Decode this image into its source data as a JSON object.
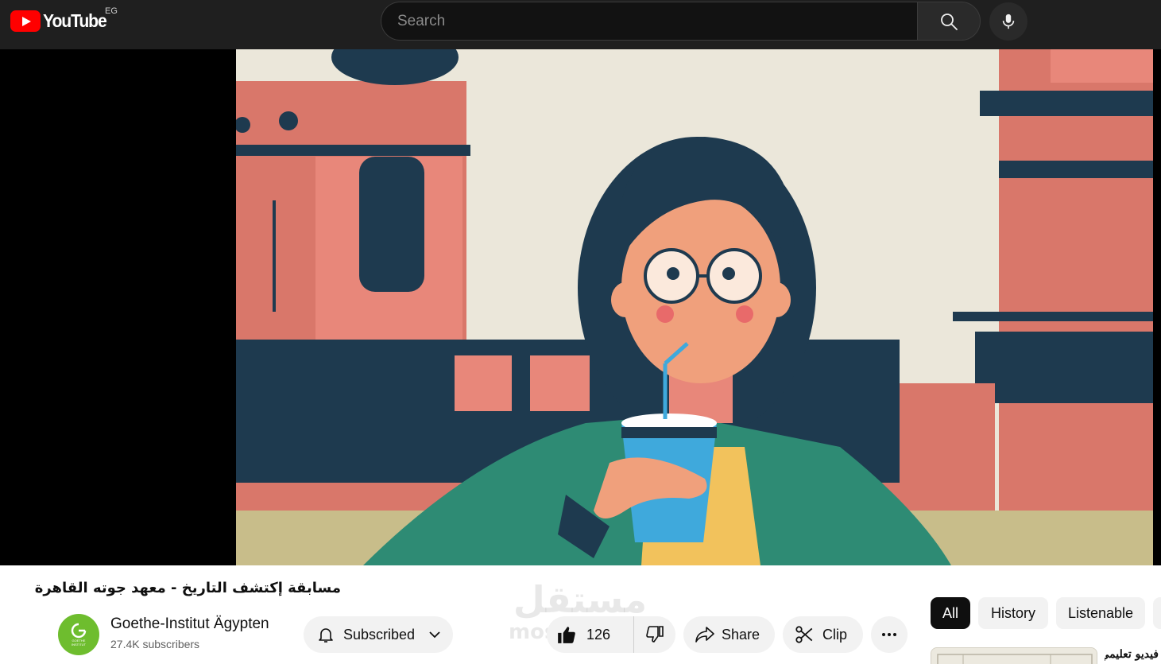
{
  "header": {
    "logo_text": "YouTube",
    "region": "EG",
    "search_placeholder": "Search",
    "search_icon": "search-icon",
    "mic_icon": "microphone-icon"
  },
  "video": {
    "title": "مسابقة إكتشف التاريخ - معهد جوته القاهرة",
    "illustration": "animated woman with glasses drinking from blue cup in front of terracotta buildings"
  },
  "channel": {
    "name": "Goethe-Institut Ägypten",
    "subscribers": "27.4K subscribers",
    "avatar_color": "#6ebd2e",
    "avatar_text": "GOETHE INSTITUT"
  },
  "actions": {
    "subscribe_label": "Subscribed",
    "like_count": "126",
    "share_label": "Share",
    "clip_label": "Clip",
    "more_icon": "more-horizontal-icon"
  },
  "watermark": {
    "arabic": "مستقل",
    "latin": "mostaql.com"
  },
  "chips": [
    {
      "label": "All",
      "active": true
    },
    {
      "label": "History",
      "active": false
    },
    {
      "label": "Listenable",
      "active": false
    }
  ],
  "recommendation": {
    "title": "فيديو تعليمي"
  },
  "colors": {
    "topbar": "#1f1f1f",
    "brand_red": "#ff0000",
    "chip_active": "#0f0f0f",
    "pill_bg": "#f2f2f2"
  }
}
